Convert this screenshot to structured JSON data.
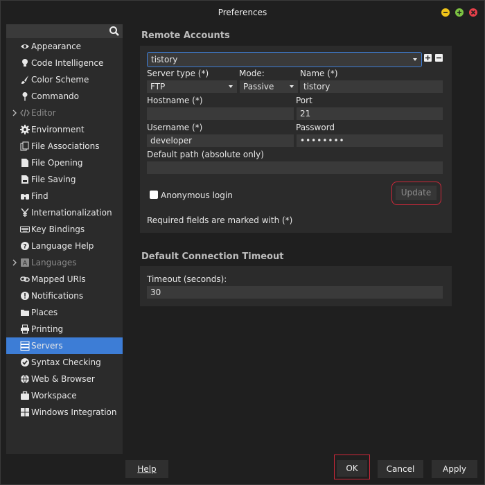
{
  "window": {
    "title": "Preferences"
  },
  "sidebar": {
    "search_placeholder": "",
    "items": [
      {
        "label": "Appearance",
        "icon": "eye-icon",
        "expandable": false,
        "selected": false,
        "disabled": false
      },
      {
        "label": "Code Intelligence",
        "icon": "lightbulb-icon",
        "expandable": false,
        "selected": false,
        "disabled": false
      },
      {
        "label": "Color Scheme",
        "icon": "paintbrush-icon",
        "expandable": false,
        "selected": false,
        "disabled": false
      },
      {
        "label": "Commando",
        "icon": "pin-icon",
        "expandable": false,
        "selected": false,
        "disabled": false
      },
      {
        "label": "Editor",
        "icon": "code-icon",
        "expandable": true,
        "selected": false,
        "disabled": true
      },
      {
        "label": "Environment",
        "icon": "gear-icon",
        "expandable": false,
        "selected": false,
        "disabled": false
      },
      {
        "label": "File Associations",
        "icon": "files-icon",
        "expandable": false,
        "selected": false,
        "disabled": false
      },
      {
        "label": "File Opening",
        "icon": "file-icon",
        "expandable": false,
        "selected": false,
        "disabled": false
      },
      {
        "label": "File Saving",
        "icon": "file-save-icon",
        "expandable": false,
        "selected": false,
        "disabled": false
      },
      {
        "label": "Find",
        "icon": "binoculars-icon",
        "expandable": false,
        "selected": false,
        "disabled": false
      },
      {
        "label": "Internationalization",
        "icon": "yen-icon",
        "expandable": false,
        "selected": false,
        "disabled": false
      },
      {
        "label": "Key Bindings",
        "icon": "keyboard-icon",
        "expandable": false,
        "selected": false,
        "disabled": false
      },
      {
        "label": "Language Help",
        "icon": "help-circle-icon",
        "expandable": false,
        "selected": false,
        "disabled": false
      },
      {
        "label": "Languages",
        "icon": "languages-icon",
        "expandable": true,
        "selected": false,
        "disabled": true
      },
      {
        "label": "Mapped URIs",
        "icon": "link-icon",
        "expandable": false,
        "selected": false,
        "disabled": false
      },
      {
        "label": "Notifications",
        "icon": "exclamation-circle-icon",
        "expandable": false,
        "selected": false,
        "disabled": false
      },
      {
        "label": "Places",
        "icon": "folder-icon",
        "expandable": false,
        "selected": false,
        "disabled": false
      },
      {
        "label": "Printing",
        "icon": "printer-icon",
        "expandable": false,
        "selected": false,
        "disabled": false
      },
      {
        "label": "Servers",
        "icon": "server-icon",
        "expandable": false,
        "selected": true,
        "disabled": false
      },
      {
        "label": "Syntax Checking",
        "icon": "check-circle-icon",
        "expandable": false,
        "selected": false,
        "disabled": false
      },
      {
        "label": "Web & Browser",
        "icon": "globe-icon",
        "expandable": false,
        "selected": false,
        "disabled": false
      },
      {
        "label": "Workspace",
        "icon": "briefcase-icon",
        "expandable": false,
        "selected": false,
        "disabled": false
      },
      {
        "label": "Windows Integration",
        "icon": "windows-icon",
        "expandable": false,
        "selected": false,
        "disabled": false
      }
    ]
  },
  "remote_accounts": {
    "title": "Remote Accounts",
    "account_select": "tistory",
    "server_type_label": "Server type (*)",
    "server_type_value": "FTP",
    "mode_label": "Mode:",
    "mode_value": "Passive",
    "name_label": "Name (*)",
    "name_value": "tistory",
    "hostname_label": "Hostname (*)",
    "hostname_value": "",
    "port_label": "Port",
    "port_value": "21",
    "username_label": "Username (*)",
    "username_value": "developer",
    "password_label": "Password",
    "password_value": "••••••••",
    "default_path_label": "Default path (absolute only)",
    "default_path_value": "",
    "anonymous_label": "Anonymous login",
    "update_label": "Update",
    "required_note": "Required fields are marked with (*)"
  },
  "timeout": {
    "title": "Default Connection Timeout",
    "label": "Timeout (seconds):",
    "value": "30"
  },
  "buttons": {
    "help": "Help",
    "ok": "OK",
    "cancel": "Cancel",
    "apply": "Apply"
  },
  "colors": {
    "accent": "#3d7dd6",
    "highlight_outline": "#d0283a",
    "minimize": "#f0c419",
    "maximize": "#7cc242",
    "close": "#e8404a"
  }
}
